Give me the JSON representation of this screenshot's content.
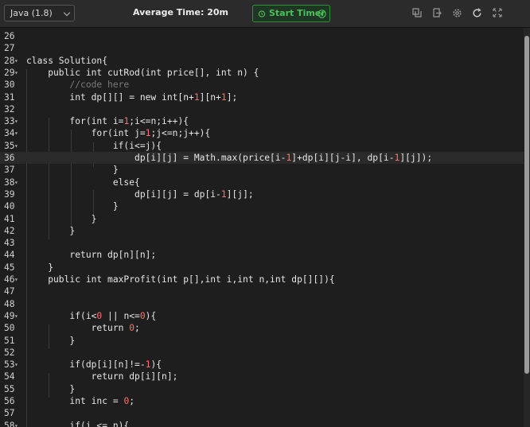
{
  "toolbar": {
    "language": "Java (1.8)",
    "average_time": "Average Time: 20m",
    "timer_label": "Start Timer",
    "icons": [
      "copy-icon",
      "export-icon",
      "settings-icon",
      "reset-icon",
      "fullscreen-icon"
    ]
  },
  "editor": {
    "colors": {
      "background": "#1e1e1e",
      "text": "#e6e6e6",
      "number": "#ff6f6f",
      "comment": "#7a7a7a",
      "accent": "#4bbf5a"
    },
    "active_line": "36",
    "lines": [
      {
        "n": "26",
        "text": "",
        "fold": false
      },
      {
        "n": "27",
        "text": "",
        "fold": false
      },
      {
        "n": "28",
        "text": "class Solution{",
        "fold": true
      },
      {
        "n": "29",
        "text": "    public int cutRod(int price[], int n) {",
        "fold": true
      },
      {
        "n": "30",
        "text": "        //code here",
        "fold": false
      },
      {
        "n": "31",
        "text": "        int dp[][] = new int[n+1][n+1];",
        "fold": false
      },
      {
        "n": "32",
        "text": "",
        "fold": false
      },
      {
        "n": "33",
        "text": "        for(int i=1;i<=n;i++){",
        "fold": true
      },
      {
        "n": "34",
        "text": "            for(int j=1;j<=n;j++){",
        "fold": true
      },
      {
        "n": "35",
        "text": "                if(i<=j){",
        "fold": true
      },
      {
        "n": "36",
        "text": "                    dp[i][j] = Math.max(price[i-1]+dp[i][j-i], dp[i-1][j]);",
        "fold": false
      },
      {
        "n": "37",
        "text": "                }",
        "fold": false
      },
      {
        "n": "38",
        "text": "                else{",
        "fold": true
      },
      {
        "n": "39",
        "text": "                    dp[i][j] = dp[i-1][j];",
        "fold": false
      },
      {
        "n": "40",
        "text": "                }",
        "fold": false
      },
      {
        "n": "41",
        "text": "            }",
        "fold": false
      },
      {
        "n": "42",
        "text": "        }",
        "fold": false
      },
      {
        "n": "43",
        "text": "",
        "fold": false
      },
      {
        "n": "44",
        "text": "        return dp[n][n];",
        "fold": false
      },
      {
        "n": "45",
        "text": "    }",
        "fold": false
      },
      {
        "n": "46",
        "text": "    public int maxProfit(int p[],int i,int n,int dp[][]){",
        "fold": true
      },
      {
        "n": "47",
        "text": "",
        "fold": false
      },
      {
        "n": "48",
        "text": "",
        "fold": false
      },
      {
        "n": "49",
        "text": "        if(i<0 || n<=0){",
        "fold": true
      },
      {
        "n": "50",
        "text": "            return 0;",
        "fold": false
      },
      {
        "n": "51",
        "text": "        }",
        "fold": false
      },
      {
        "n": "52",
        "text": "",
        "fold": false
      },
      {
        "n": "53",
        "text": "        if(dp[i][n]!=-1){",
        "fold": true
      },
      {
        "n": "54",
        "text": "            return dp[i][n];",
        "fold": false
      },
      {
        "n": "55",
        "text": "        }",
        "fold": false
      },
      {
        "n": "56",
        "text": "        int inc = 0;",
        "fold": false
      },
      {
        "n": "57",
        "text": "",
        "fold": false
      },
      {
        "n": "58",
        "text": "        if(i <= n){",
        "fold": true
      }
    ]
  }
}
